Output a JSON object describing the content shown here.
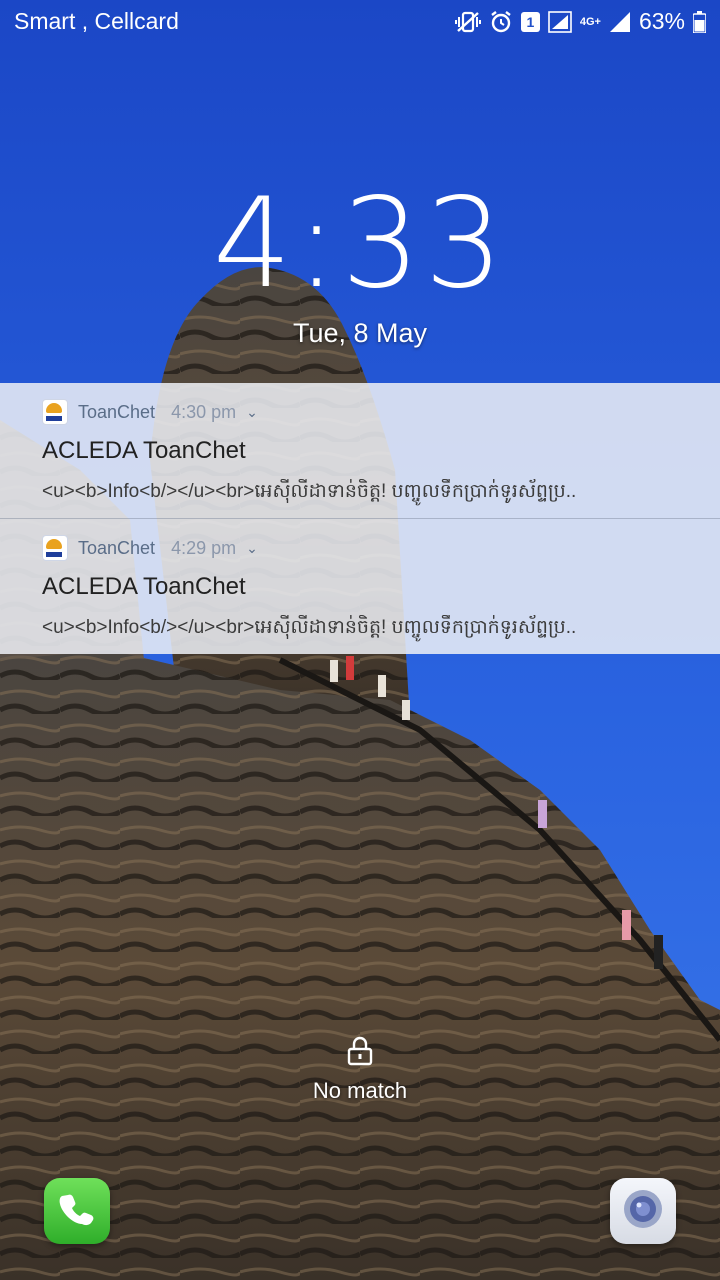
{
  "status_bar": {
    "carrier": "Smart , Cellcard",
    "sim_badge": "1",
    "network": "4G+",
    "battery": "63%"
  },
  "lockscreen": {
    "time": "4:33",
    "date": "Tue, 8 May",
    "lock_status": "No match"
  },
  "notifications": [
    {
      "app": "ToanChet",
      "time": "4:30 pm",
      "title": "ACLEDA ToanChet",
      "body": "<u><b>Info<b/></u><br>អេស៊ីលីដាទាន់ចិត្ត! បញ្ចូលទឹកប្រាក់ទូរស័ព្ទប្រ.."
    },
    {
      "app": "ToanChet",
      "time": "4:29 pm",
      "title": "ACLEDA ToanChet",
      "body": "<u><b>Info<b/></u><br>អេស៊ីលីដាទាន់ចិត្ត! បញ្ចូលទឹកប្រាក់ទូរស័ព្ទប្រ.."
    }
  ],
  "shortcuts": {
    "left": "phone-icon",
    "right": "camera-icon"
  },
  "colors": {
    "sky": "#1f4fd0",
    "phone_green": "#3cbf34"
  }
}
